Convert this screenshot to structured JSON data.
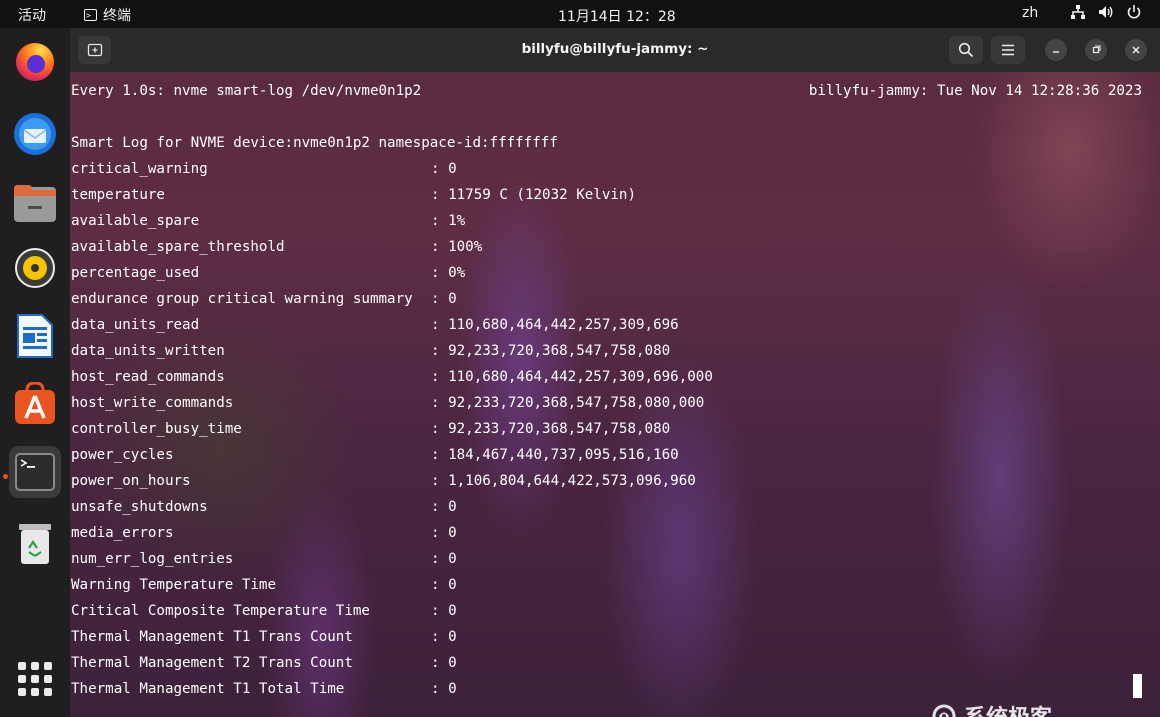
{
  "topbar": {
    "activities": "活动",
    "app_name": "终端",
    "clock": "11月14日  12：28",
    "language": "zh"
  },
  "dock": {
    "items": [
      {
        "name": "firefox",
        "icon": "firefox-icon"
      },
      {
        "name": "thunderbird",
        "icon": "thunderbird-icon"
      },
      {
        "name": "files",
        "icon": "files-icon"
      },
      {
        "name": "rhythmbox",
        "icon": "rhythmbox-icon"
      },
      {
        "name": "libreoffice-writer",
        "icon": "writer-icon"
      },
      {
        "name": "app-center",
        "icon": "app-center-icon"
      },
      {
        "name": "terminal",
        "icon": "terminal-icon",
        "active": true
      },
      {
        "name": "trash",
        "icon": "trash-icon"
      }
    ],
    "show_apps_icon": "apps-grid-icon"
  },
  "window": {
    "title": "billyfu@billyfu-jammy: ~"
  },
  "terminal": {
    "header_left": "Every 1.0s: nvme smart-log /dev/nvme0n1p2",
    "header_right": "billyfu-jammy: Tue Nov 14 12:28:36 2023",
    "log_title": "Smart Log for NVME device:nvme0n1p2 namespace-id:ffffffff",
    "rows": [
      {
        "key": "critical_warning",
        "value": ": 0"
      },
      {
        "key": "temperature",
        "value": ": 11759 C (12032 Kelvin)"
      },
      {
        "key": "available_spare",
        "value": ": 1%"
      },
      {
        "key": "available_spare_threshold",
        "value": ": 100%"
      },
      {
        "key": "percentage_used",
        "value": ": 0%"
      },
      {
        "key": "endurance group critical warning summary",
        "value": ": 0"
      },
      {
        "key": "data_units_read",
        "value": ": 110,680,464,442,257,309,696"
      },
      {
        "key": "data_units_written",
        "value": ": 92,233,720,368,547,758,080"
      },
      {
        "key": "host_read_commands",
        "value": ": 110,680,464,442,257,309,696,000"
      },
      {
        "key": "host_write_commands",
        "value": ": 92,233,720,368,547,758,080,000"
      },
      {
        "key": "controller_busy_time",
        "value": ": 92,233,720,368,547,758,080"
      },
      {
        "key": "power_cycles",
        "value": ": 184,467,440,737,095,516,160"
      },
      {
        "key": "power_on_hours",
        "value": ": 1,106,804,644,422,573,096,960"
      },
      {
        "key": "unsafe_shutdowns",
        "value": ": 0"
      },
      {
        "key": "media_errors",
        "value": ": 0"
      },
      {
        "key": "num_err_log_entries",
        "value": ": 0"
      },
      {
        "key": "Warning Temperature Time",
        "value": ": 0"
      },
      {
        "key": "Critical Composite Temperature Time",
        "value": ": 0"
      },
      {
        "key": "Thermal Management T1 Trans Count",
        "value": ": 0"
      },
      {
        "key": "Thermal Management T2 Trans Count",
        "value": ": 0"
      },
      {
        "key": "Thermal Management T1 Total Time",
        "value": ": 0"
      }
    ]
  },
  "watermark": {
    "text": "系统极客"
  }
}
